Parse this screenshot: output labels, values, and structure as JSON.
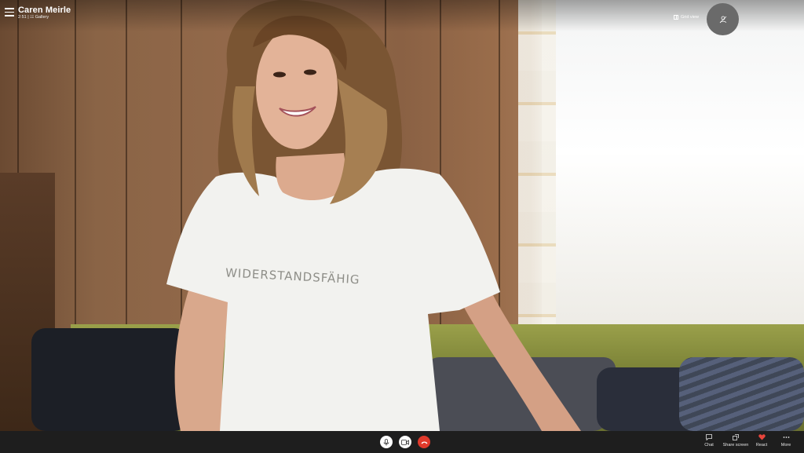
{
  "call": {
    "caller_name": "Caren Meirle",
    "duration": "2:51",
    "separator": "|",
    "view_mode": "Gallery"
  },
  "top_controls": {
    "grid_view_label": "Grid view",
    "self_view_icon": "person-hidden-icon"
  },
  "tshirt_text": "WIDERSTANDSFÄHIG",
  "call_controls": {
    "mute_icon": "microphone-icon",
    "video_icon": "video-camera-icon",
    "hangup_icon": "phone-hangup-icon"
  },
  "right_controls": [
    {
      "label": "Chat",
      "icon": "chat-icon"
    },
    {
      "label": "Share screen",
      "icon": "share-screen-icon"
    },
    {
      "label": "React",
      "icon": "heart-icon"
    },
    {
      "label": "More",
      "icon": "more-icon"
    }
  ],
  "colors": {
    "hangup": "#e0392b",
    "react_heart": "#e8453c",
    "bar": "#1e1e1e"
  }
}
